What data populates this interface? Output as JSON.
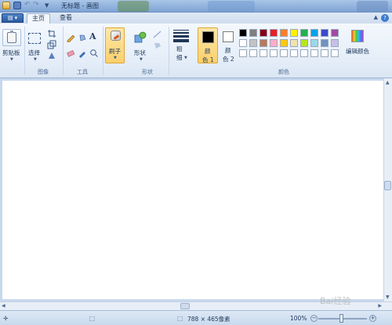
{
  "window": {
    "title": "无标题 - 画图",
    "tabs": [
      "主页",
      "查看"
    ],
    "help": "?"
  },
  "ribbon": {
    "clipboard": {
      "label": "剪贴板"
    },
    "image": {
      "group_label": "图像",
      "select_label": "选择"
    },
    "tools": {
      "group_label": "工具"
    },
    "brush": {
      "label": "刷子"
    },
    "shapes": {
      "group_label": "形状",
      "shapes_label": "形状"
    },
    "size": {
      "label_line1": "粗",
      "label_line2": "细"
    },
    "colors": {
      "group_label": "颜色",
      "color1_line1": "颜",
      "color1_line2": "色 1",
      "color2_line1": "颜",
      "color2_line2": "色 2",
      "edit_label": "编辑颜色",
      "palette_row1": [
        "#000000",
        "#7f7f7f",
        "#880015",
        "#ed1c24",
        "#ff7f27",
        "#fff200",
        "#22b14c",
        "#00a2e8",
        "#3f48cc",
        "#a349a4"
      ],
      "palette_row2": [
        "#ffffff",
        "#c3c3c3",
        "#b97a57",
        "#ffaec9",
        "#ffc90e",
        "#efe4b0",
        "#b5e61d",
        "#99d9ea",
        "#7092be",
        "#c8bfe7"
      ],
      "palette_row3": [
        "#ffffff",
        "#ffffff",
        "#ffffff",
        "#ffffff",
        "#ffffff",
        "#ffffff",
        "#ffffff",
        "#ffffff",
        "#ffffff",
        "#ffffff"
      ],
      "color1": "#000000",
      "color2": "#ffffff"
    }
  },
  "status": {
    "dimensions": "788 × 465像素",
    "zoom": "100%"
  },
  "watermark": "Bai经验"
}
